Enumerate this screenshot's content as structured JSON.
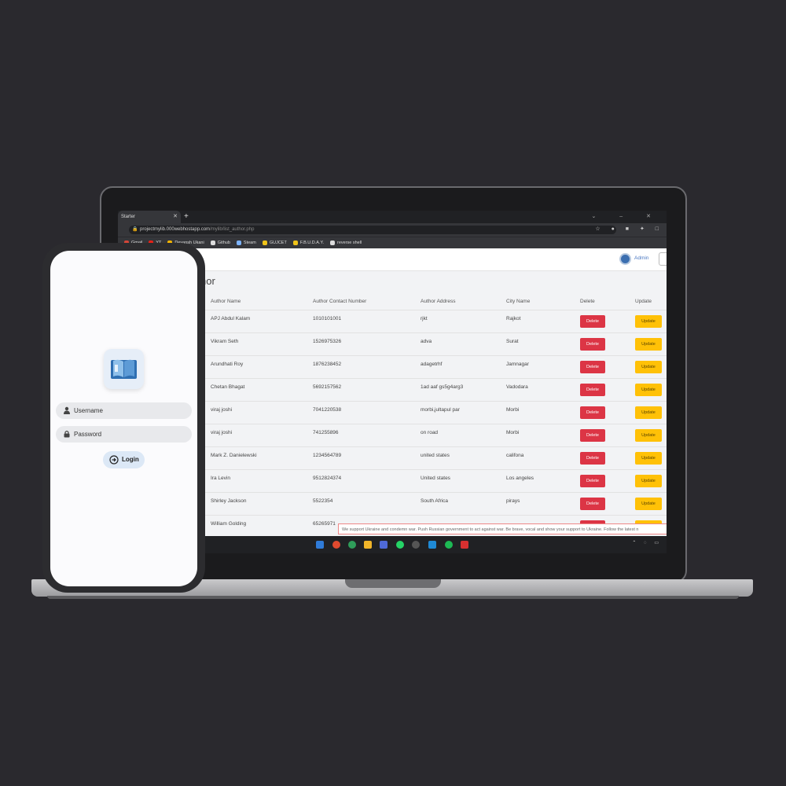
{
  "browser": {
    "tab_title": "Starter",
    "url_host": "projectmylib.000webhostapp.com",
    "url_path": "/mylib/list_author.php",
    "bookmarks": [
      "Gmail",
      "YT",
      "Devansh Ukani",
      "Github",
      "Steam",
      "GUJCET",
      "F.B.U.D.A.Y.",
      "reverse shell"
    ]
  },
  "header": {
    "user_label": "Admin"
  },
  "page": {
    "title": "hor"
  },
  "table": {
    "headers": [
      "Author Name",
      "Author Contact Number",
      "Author Address",
      "City Name",
      "Delete",
      "Update"
    ],
    "rows": [
      [
        "APJ Abdul Kalam",
        "1010101001",
        "rjkt",
        "Rajkot"
      ],
      [
        "Vikram Seth",
        "1526975326",
        "adva",
        "Surat"
      ],
      [
        "Arundhati Roy",
        "1876238452",
        "adagetrhf",
        "Jamnagar"
      ],
      [
        "Chetan Bhagat",
        "5692157562",
        "1ad aaf gs5g4arg3",
        "Vadodara"
      ],
      [
        "viraj joshi",
        "7041220538",
        "morbi,jultapul par",
        "Morbi"
      ],
      [
        "viraj joshi",
        "741255896",
        "on road",
        "Morbi"
      ],
      [
        "Mark Z. Danielewski",
        "1234564789",
        "united states",
        "califona"
      ],
      [
        "Ira Levin",
        "9512824374",
        "United states",
        "Los angeles"
      ],
      [
        "Shirley Jackson",
        "5522354",
        "South Africa",
        "pirays"
      ],
      [
        "William Golding",
        "65265971",
        "",
        ""
      ]
    ],
    "delete_label": "Delete",
    "update_label": "Update"
  },
  "notice": "We support Ukraine and condemn war. Push Russian government to act against war. Be brave, vocal and show your support to Ukraine. Follow the latest n",
  "login": {
    "username_placeholder": "Username",
    "password_placeholder": "Password",
    "login_label": "Login"
  },
  "colors": {
    "delete": "#dc3545",
    "update": "#ffc107",
    "accent": "#4a78c2",
    "background": "#2a292e"
  }
}
